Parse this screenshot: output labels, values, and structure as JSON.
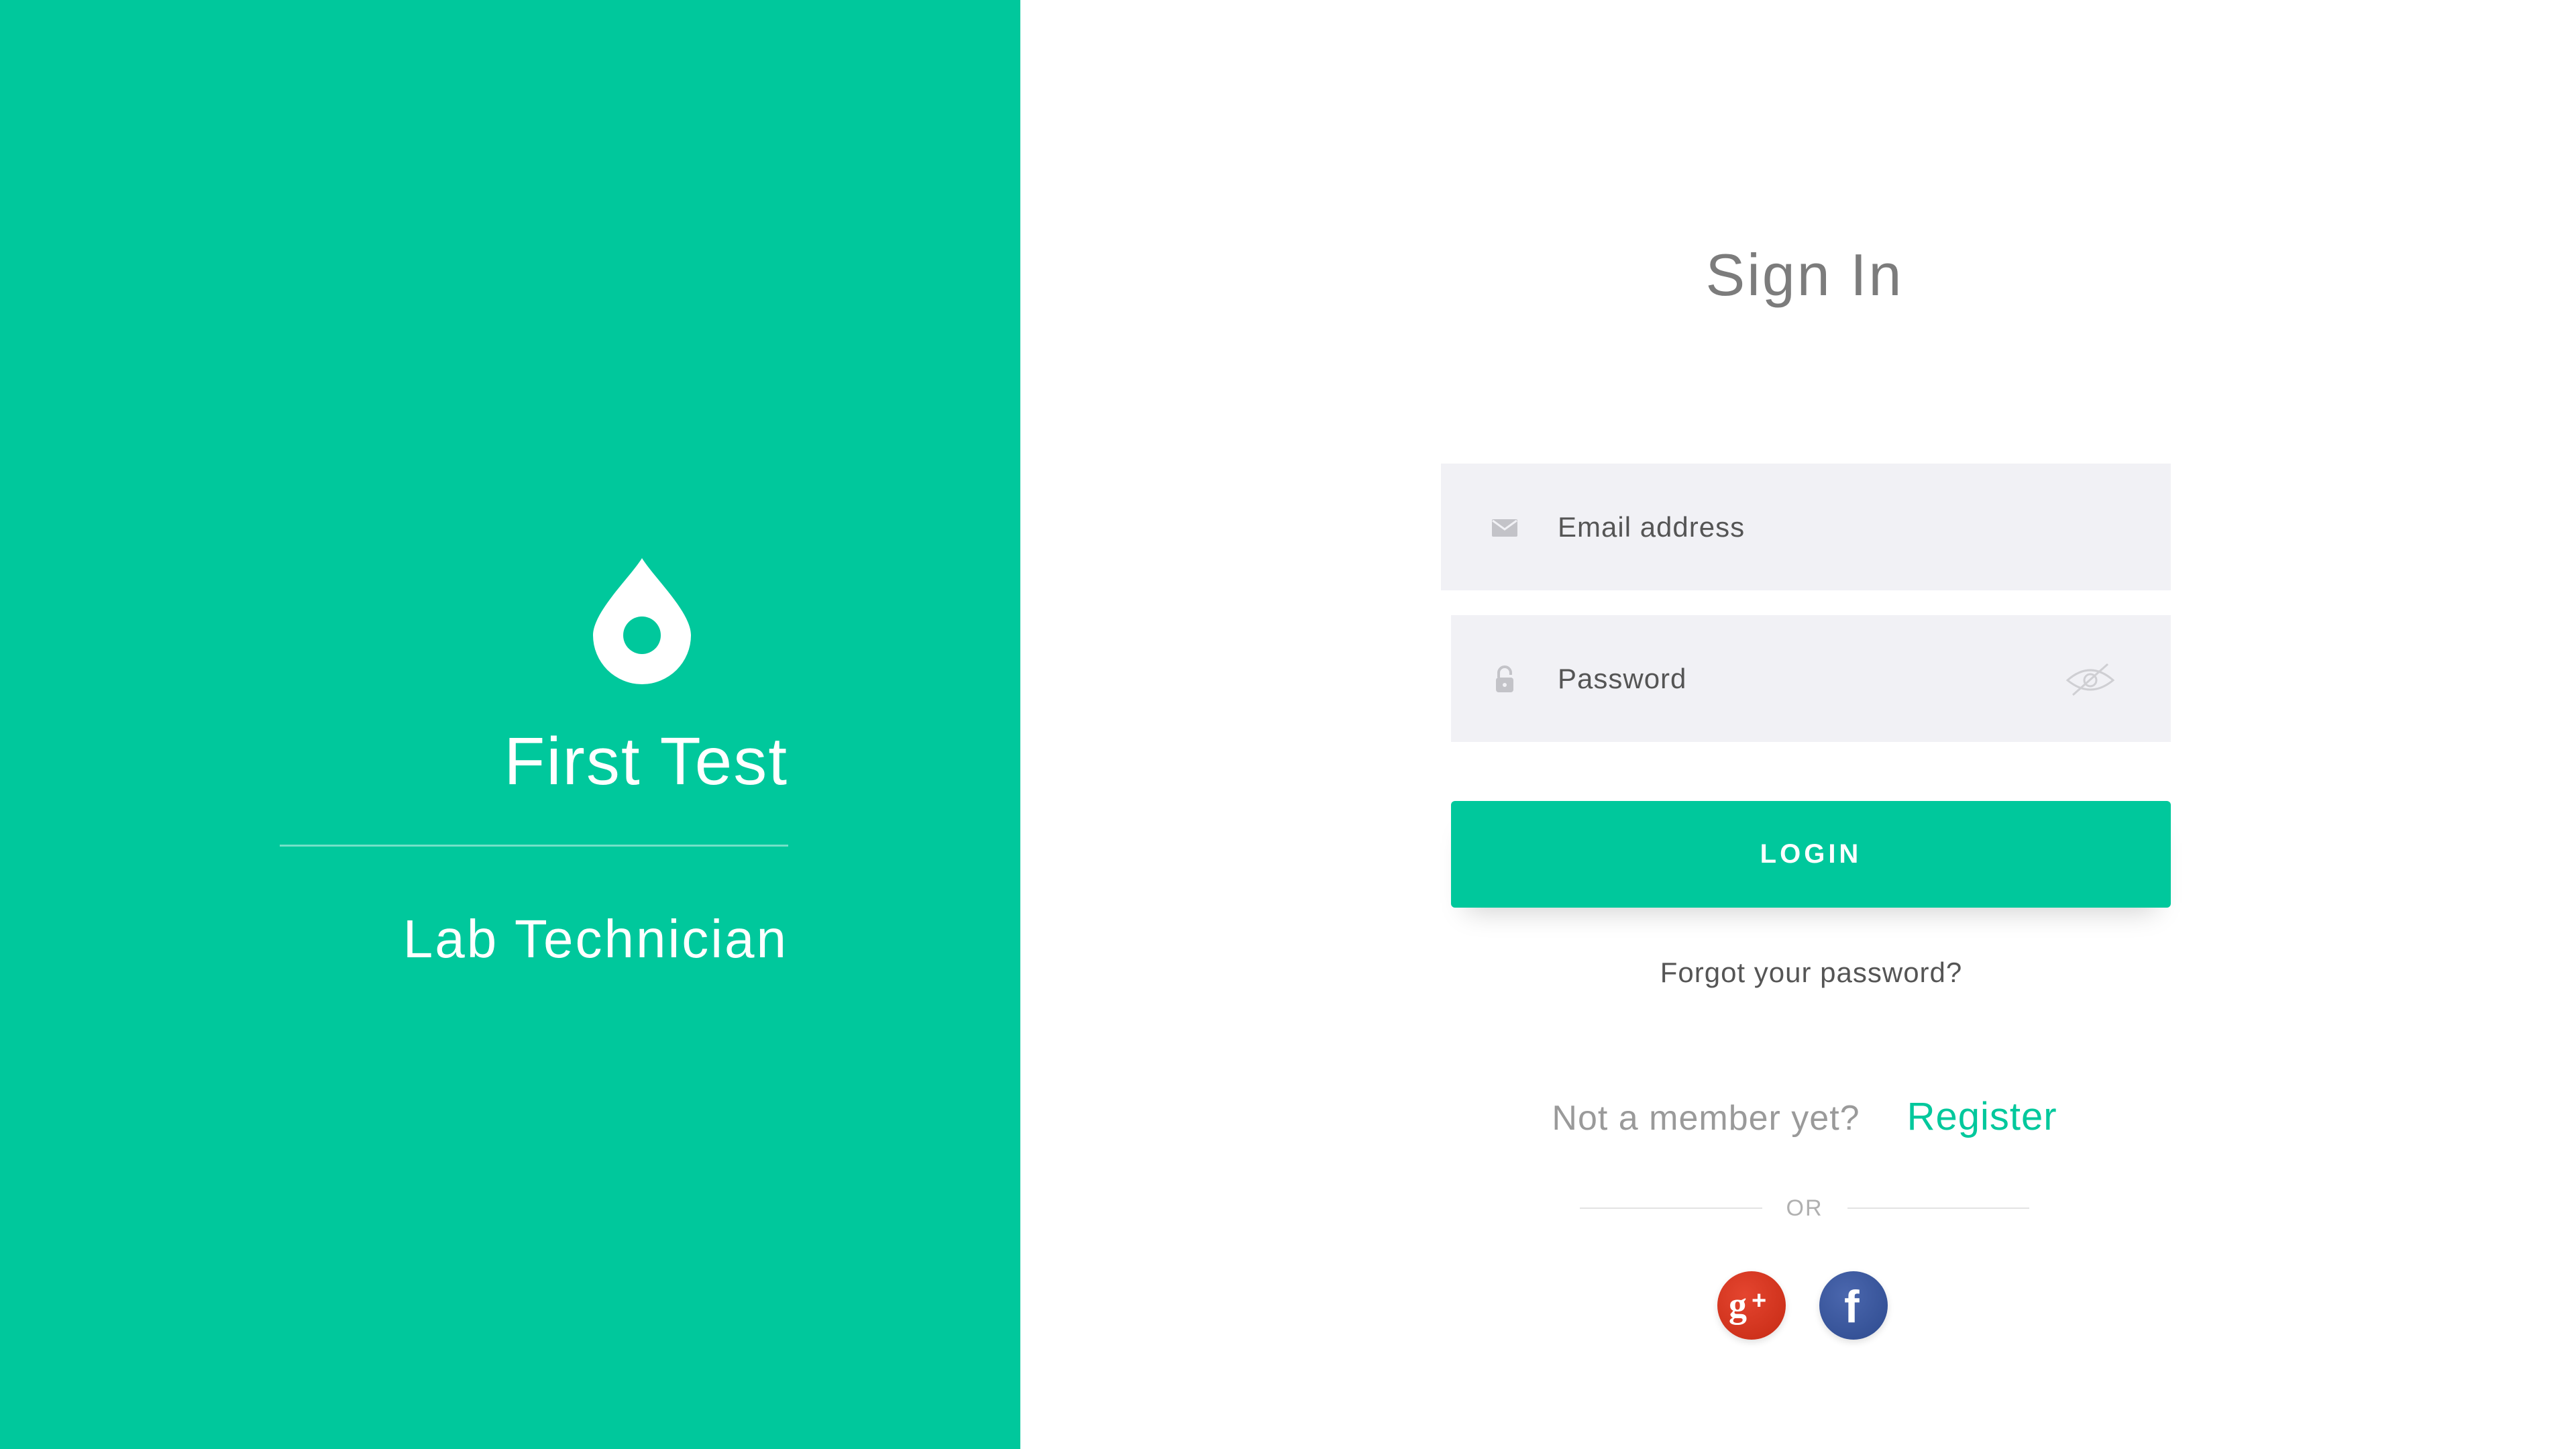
{
  "brand": {
    "title": "First Test",
    "subtitle": "Lab Technician",
    "logo_icon": "drop-icon",
    "color": "#00c89c"
  },
  "signin": {
    "title": "Sign In"
  },
  "form": {
    "email": {
      "placeholder": "Email address",
      "value": "",
      "icon": "envelope-icon"
    },
    "password": {
      "placeholder": "Password",
      "value": "",
      "icon": "lock-icon",
      "toggle_icon": "eye-slash-icon"
    },
    "login_label": "LOGIN",
    "forgot_label": "Forgot your password?"
  },
  "register": {
    "prompt": "Not a member yet?",
    "link_label": "Register"
  },
  "divider": {
    "label": "OR"
  },
  "social": [
    {
      "name": "google-plus",
      "icon": "google-plus-icon",
      "color": "#d9341e"
    },
    {
      "name": "facebook",
      "icon": "facebook-icon",
      "color": "#3b5998"
    }
  ],
  "colors": {
    "accent": "#00c89c",
    "field_bg": "#f1f1f5",
    "text_muted": "#7c7c7c"
  }
}
